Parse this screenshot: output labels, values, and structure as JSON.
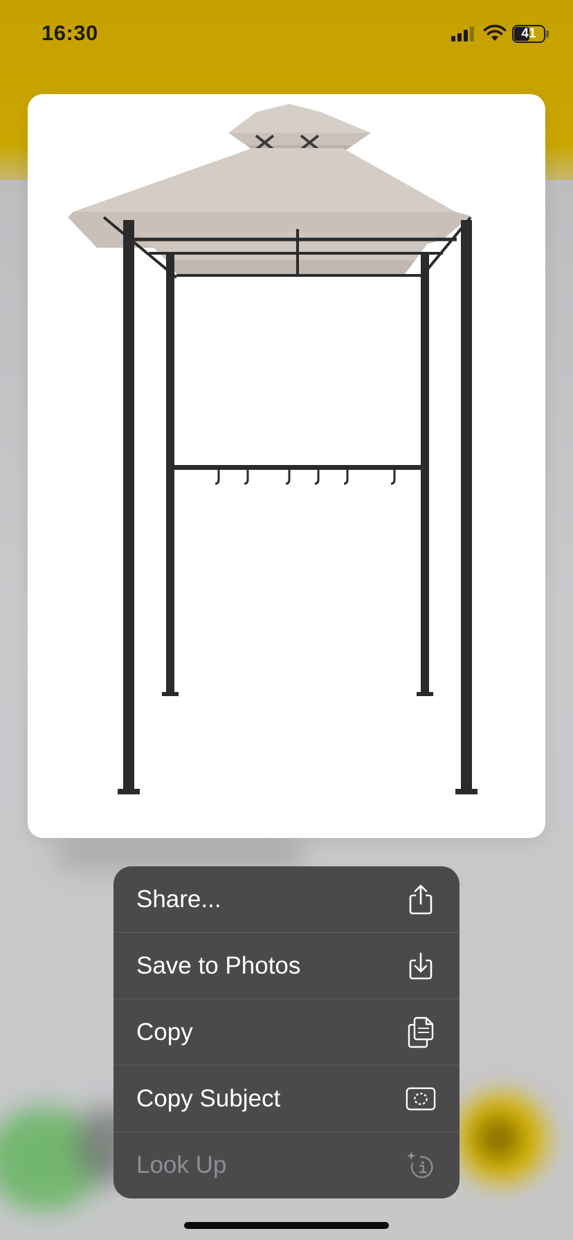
{
  "status_bar": {
    "time": "16:30",
    "battery_level": "41"
  },
  "preview": {
    "subject": "grill-gazebo-image"
  },
  "context_menu": {
    "items": [
      {
        "label": "Share...",
        "icon": "share-icon",
        "enabled": true
      },
      {
        "label": "Save to Photos",
        "icon": "save-to-photos-icon",
        "enabled": true
      },
      {
        "label": "Copy",
        "icon": "copy-icon",
        "enabled": true
      },
      {
        "label": "Copy Subject",
        "icon": "copy-subject-icon",
        "enabled": true
      },
      {
        "label": "Look Up",
        "icon": "visual-look-up-icon",
        "enabled": false
      }
    ]
  },
  "colors": {
    "menu_bg": "#4a4a4c",
    "header_yellow": "#c6a100",
    "canopy": "#d3cbc4",
    "frame": "#2b2b2b"
  }
}
